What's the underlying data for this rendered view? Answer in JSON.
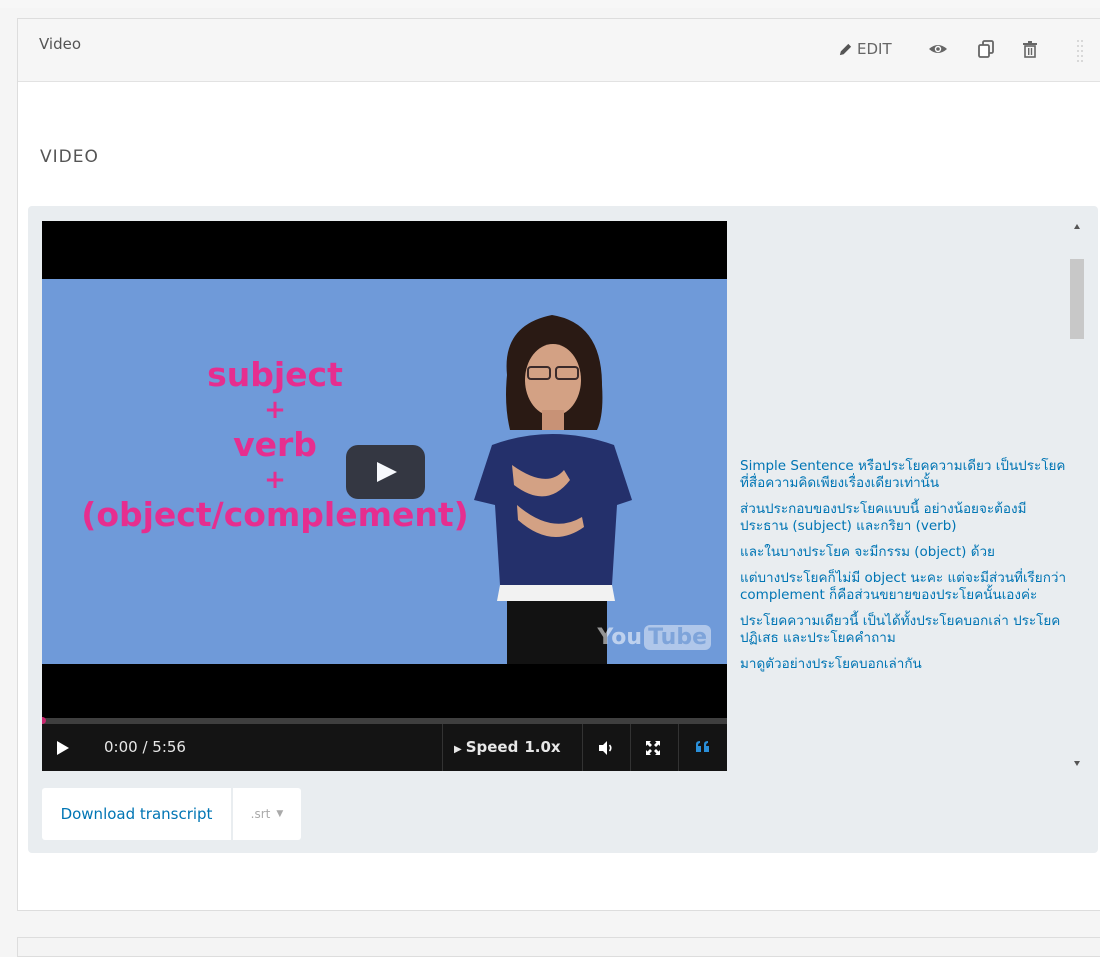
{
  "component": {
    "title": "Video",
    "actions": {
      "edit_label": "EDIT",
      "icons": [
        "pencil-icon",
        "eye-icon",
        "duplicate-icon",
        "trash-icon",
        "drag-handle-icon"
      ]
    }
  },
  "section": {
    "label": "VIDEO"
  },
  "player": {
    "slide": {
      "line1": "subject",
      "plus1": "+",
      "line2": "verb",
      "plus2": "+",
      "line3": "(object/complement)"
    },
    "watermark": {
      "you": "You",
      "tube": "Tube"
    },
    "time": "0:00 / 5:56",
    "progress": 0,
    "speed_label": "Speed",
    "speed_value": "1.0x",
    "accent_color": "#c9256d",
    "icons": [
      "play-icon",
      "volume-icon",
      "fullscreen-icon",
      "captions-icon"
    ]
  },
  "transcript": {
    "lines": [
      "Simple Sentence หรือประโยคความเดียว เป็นประโยคที่สื่อความคิดเพียงเรื่องเดียวเท่านั้น",
      "ส่วนประกอบของประโยคแบบนี้ อย่างน้อยจะต้องมีประธาน (subject) และกริยา (verb)",
      "และในบางประโยค จะมีกรรม (object) ด้วย",
      "แต่บางประโยคก็ไม่มี object นะคะ แต่จะมีส่วนที่เรียกว่า complement ก็คือส่วนขยายของประโยคนั้นเองค่ะ",
      "ประโยคความเดียวนี้ เป็นได้ทั้งประโยคบอกเล่า ประโยคปฏิเสธ และประโยคคำถาม",
      "มาดูตัวอย่างประโยคบอกเล่ากัน"
    ],
    "link_color": "#0075b4"
  },
  "download": {
    "button_label": "Download transcript",
    "format": ".srt"
  }
}
